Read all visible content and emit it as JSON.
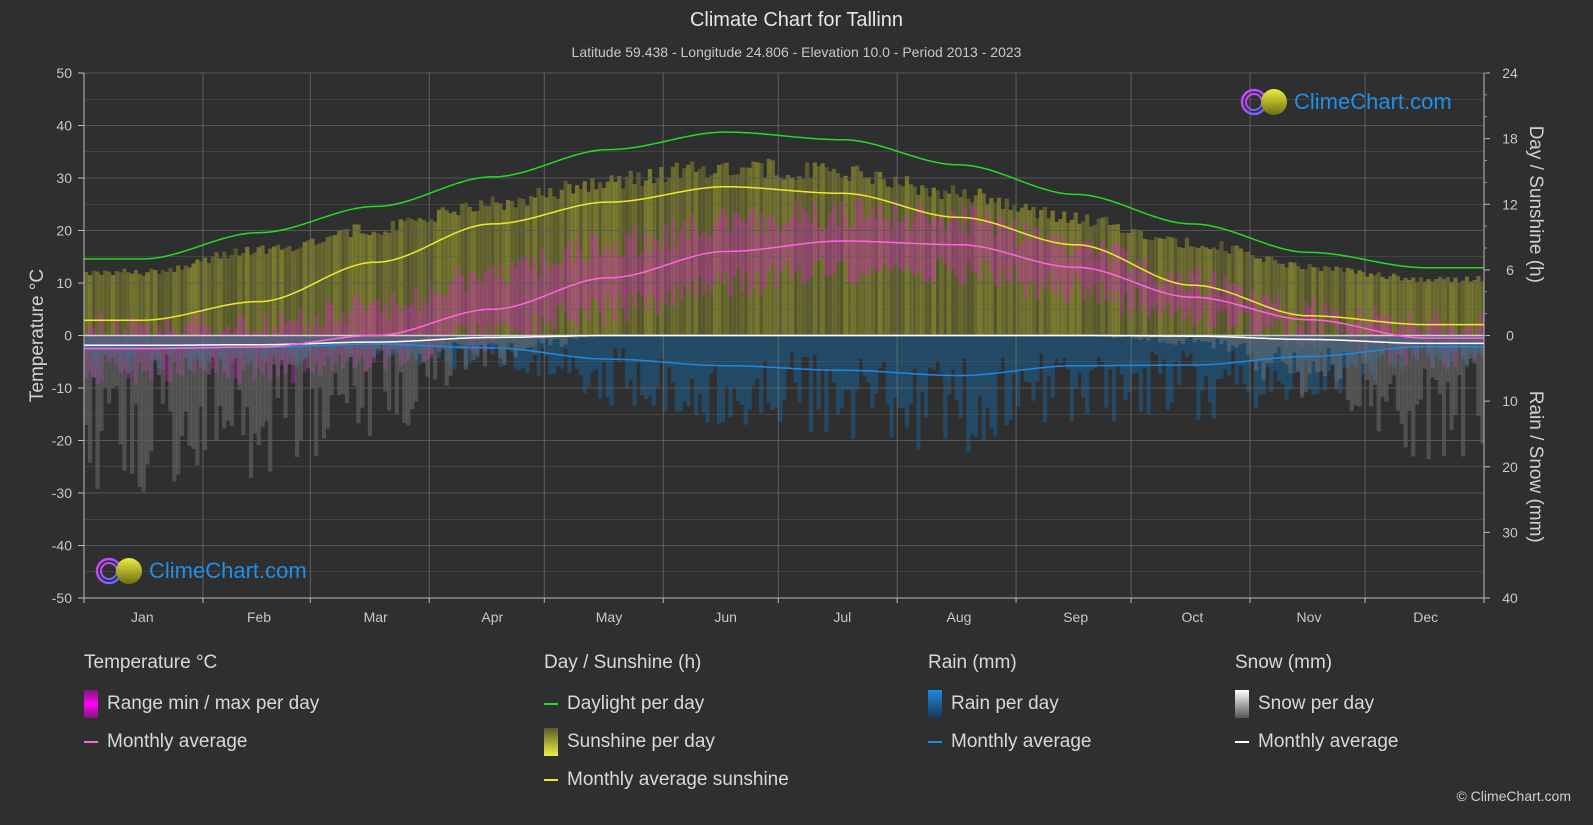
{
  "header": {
    "title": "Climate Chart for Tallinn",
    "subtitle": "Latitude 59.438 - Longitude 24.806 - Elevation 10.0 - Period 2013 - 2023"
  },
  "logo_text": "ClimeChart.com",
  "copyright": "© ClimeChart.com",
  "colors": {
    "background": "#2f2f2f",
    "daylight": "#22dd22",
    "sunshine_avg": "#f0e830",
    "sunshine_fill": "#9a9a30",
    "temp_avg": "#ff66dd",
    "temp_range": "#dd22cc",
    "rain_avg": "#1e88e5",
    "rain_fill": "#1a5f8f",
    "snow_avg": "#ffffff",
    "snow_fill": "#7a7a7a",
    "grid": "#5a5a5a",
    "logo_blue": "#1e90e8"
  },
  "legend": {
    "temperature": {
      "title": "Temperature °C",
      "items": [
        "Range min / max per day",
        "Monthly average"
      ]
    },
    "sunshine": {
      "title": "Day / Sunshine (h)",
      "items": [
        "Daylight per day",
        "Sunshine per day",
        "Monthly average sunshine"
      ]
    },
    "rain": {
      "title": "Rain (mm)",
      "items": [
        "Rain per day",
        "Monthly average"
      ]
    },
    "snow": {
      "title": "Snow (mm)",
      "items": [
        "Snow per day",
        "Monthly average"
      ]
    }
  },
  "chart_data": {
    "type": "line",
    "title": "Climate Chart for Tallinn",
    "categories": [
      "Jan",
      "Feb",
      "Mar",
      "Apr",
      "May",
      "Jun",
      "Jul",
      "Aug",
      "Sep",
      "Oct",
      "Nov",
      "Dec"
    ],
    "axes": {
      "left": {
        "label": "Temperature °C",
        "range": [
          -50,
          50
        ],
        "ticks": [
          "50",
          "40",
          "30",
          "20",
          "10",
          "0",
          "-10",
          "-20",
          "-30",
          "-40",
          "-50"
        ]
      },
      "right_top": {
        "label": "Day / Sunshine (h)",
        "range": [
          0,
          24
        ],
        "ticks": [
          "24",
          "18",
          "12",
          "6",
          "0"
        ]
      },
      "right_bottom": {
        "label": "Rain / Snow (mm)",
        "range": [
          0,
          40
        ],
        "ticks": [
          "10",
          "20",
          "30",
          "40"
        ]
      }
    },
    "grid": true,
    "legend_position": "bottom",
    "series": [
      {
        "name": "Daylight per day",
        "axis": "right_top",
        "values": [
          7.0,
          9.4,
          11.8,
          14.5,
          17.0,
          18.6,
          17.9,
          15.6,
          12.9,
          10.2,
          7.6,
          6.2
        ]
      },
      {
        "name": "Monthly average sunshine",
        "axis": "right_top",
        "values": [
          1.4,
          3.1,
          6.7,
          10.2,
          12.2,
          13.6,
          13.0,
          10.8,
          8.3,
          4.6,
          1.8,
          1.0
        ]
      },
      {
        "name": "Temperature monthly average",
        "axis": "left",
        "values": [
          -2.5,
          -2.2,
          0.0,
          5.0,
          11.0,
          16.0,
          18.0,
          17.3,
          13.0,
          7.3,
          3.0,
          -0.5
        ]
      },
      {
        "name": "Temperature daily max (approx.)",
        "axis": "left",
        "values": [
          1.5,
          2.0,
          5.5,
          11.5,
          17.0,
          21.5,
          23.5,
          22.0,
          17.0,
          10.0,
          4.5,
          2.0
        ]
      },
      {
        "name": "Temperature daily min (approx.)",
        "axis": "left",
        "values": [
          -6.5,
          -6.5,
          -4.5,
          0.0,
          5.0,
          10.0,
          13.0,
          12.5,
          8.5,
          4.0,
          0.5,
          -3.5
        ]
      },
      {
        "name": "Rain monthly average",
        "axis": "right_bottom",
        "values": [
          1.9,
          1.8,
          1.3,
          1.9,
          3.6,
          4.6,
          5.3,
          6.1,
          4.6,
          4.5,
          3.2,
          1.7
        ]
      },
      {
        "name": "Snow monthly average",
        "axis": "right_bottom",
        "values": [
          1.5,
          1.4,
          1.0,
          0.3,
          0.0,
          0.0,
          0.0,
          0.0,
          0.0,
          0.1,
          0.6,
          1.2
        ]
      }
    ]
  }
}
